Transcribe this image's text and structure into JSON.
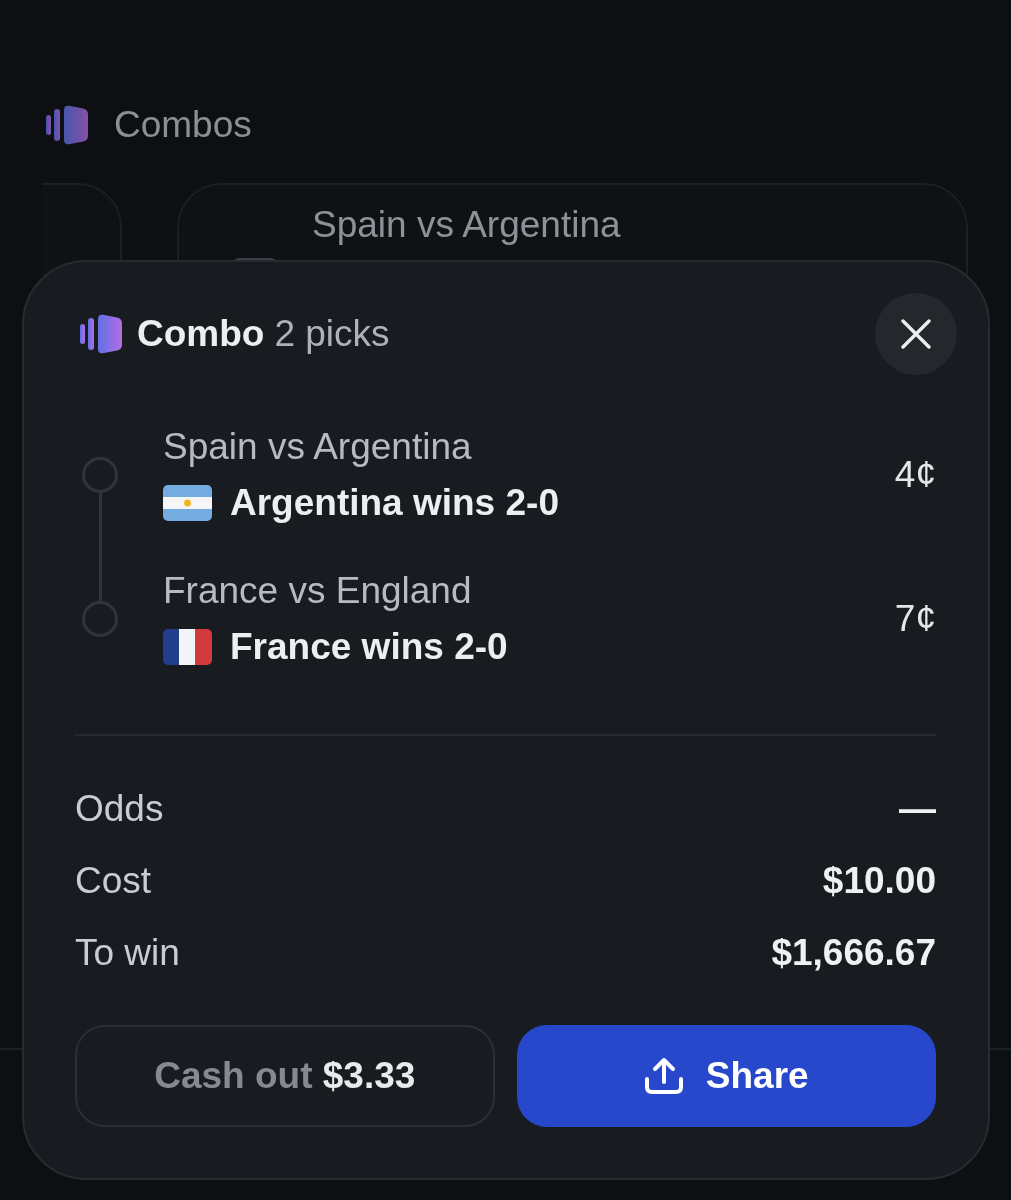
{
  "header": {
    "title": "Combos"
  },
  "background_card": {
    "matchup": "Spain vs Argentina"
  },
  "combo": {
    "title": "Combo",
    "pick_count": "2 picks",
    "picks": [
      {
        "matchup": "Spain vs Argentina",
        "kind": "argentina",
        "selection": "Argentina wins 2-0",
        "price": "4¢"
      },
      {
        "matchup": "France vs England",
        "kind": "france",
        "selection": "France wins 2-0",
        "price": "7¢"
      }
    ],
    "summary": [
      {
        "label": "Odds",
        "value": "—"
      },
      {
        "label": "Cost",
        "value": "$10.00"
      },
      {
        "label": "To win",
        "value": "$1,666.67"
      }
    ],
    "cash_out": {
      "label": "Cash out",
      "amount": "$3.33"
    },
    "share": {
      "label": "Share"
    }
  }
}
